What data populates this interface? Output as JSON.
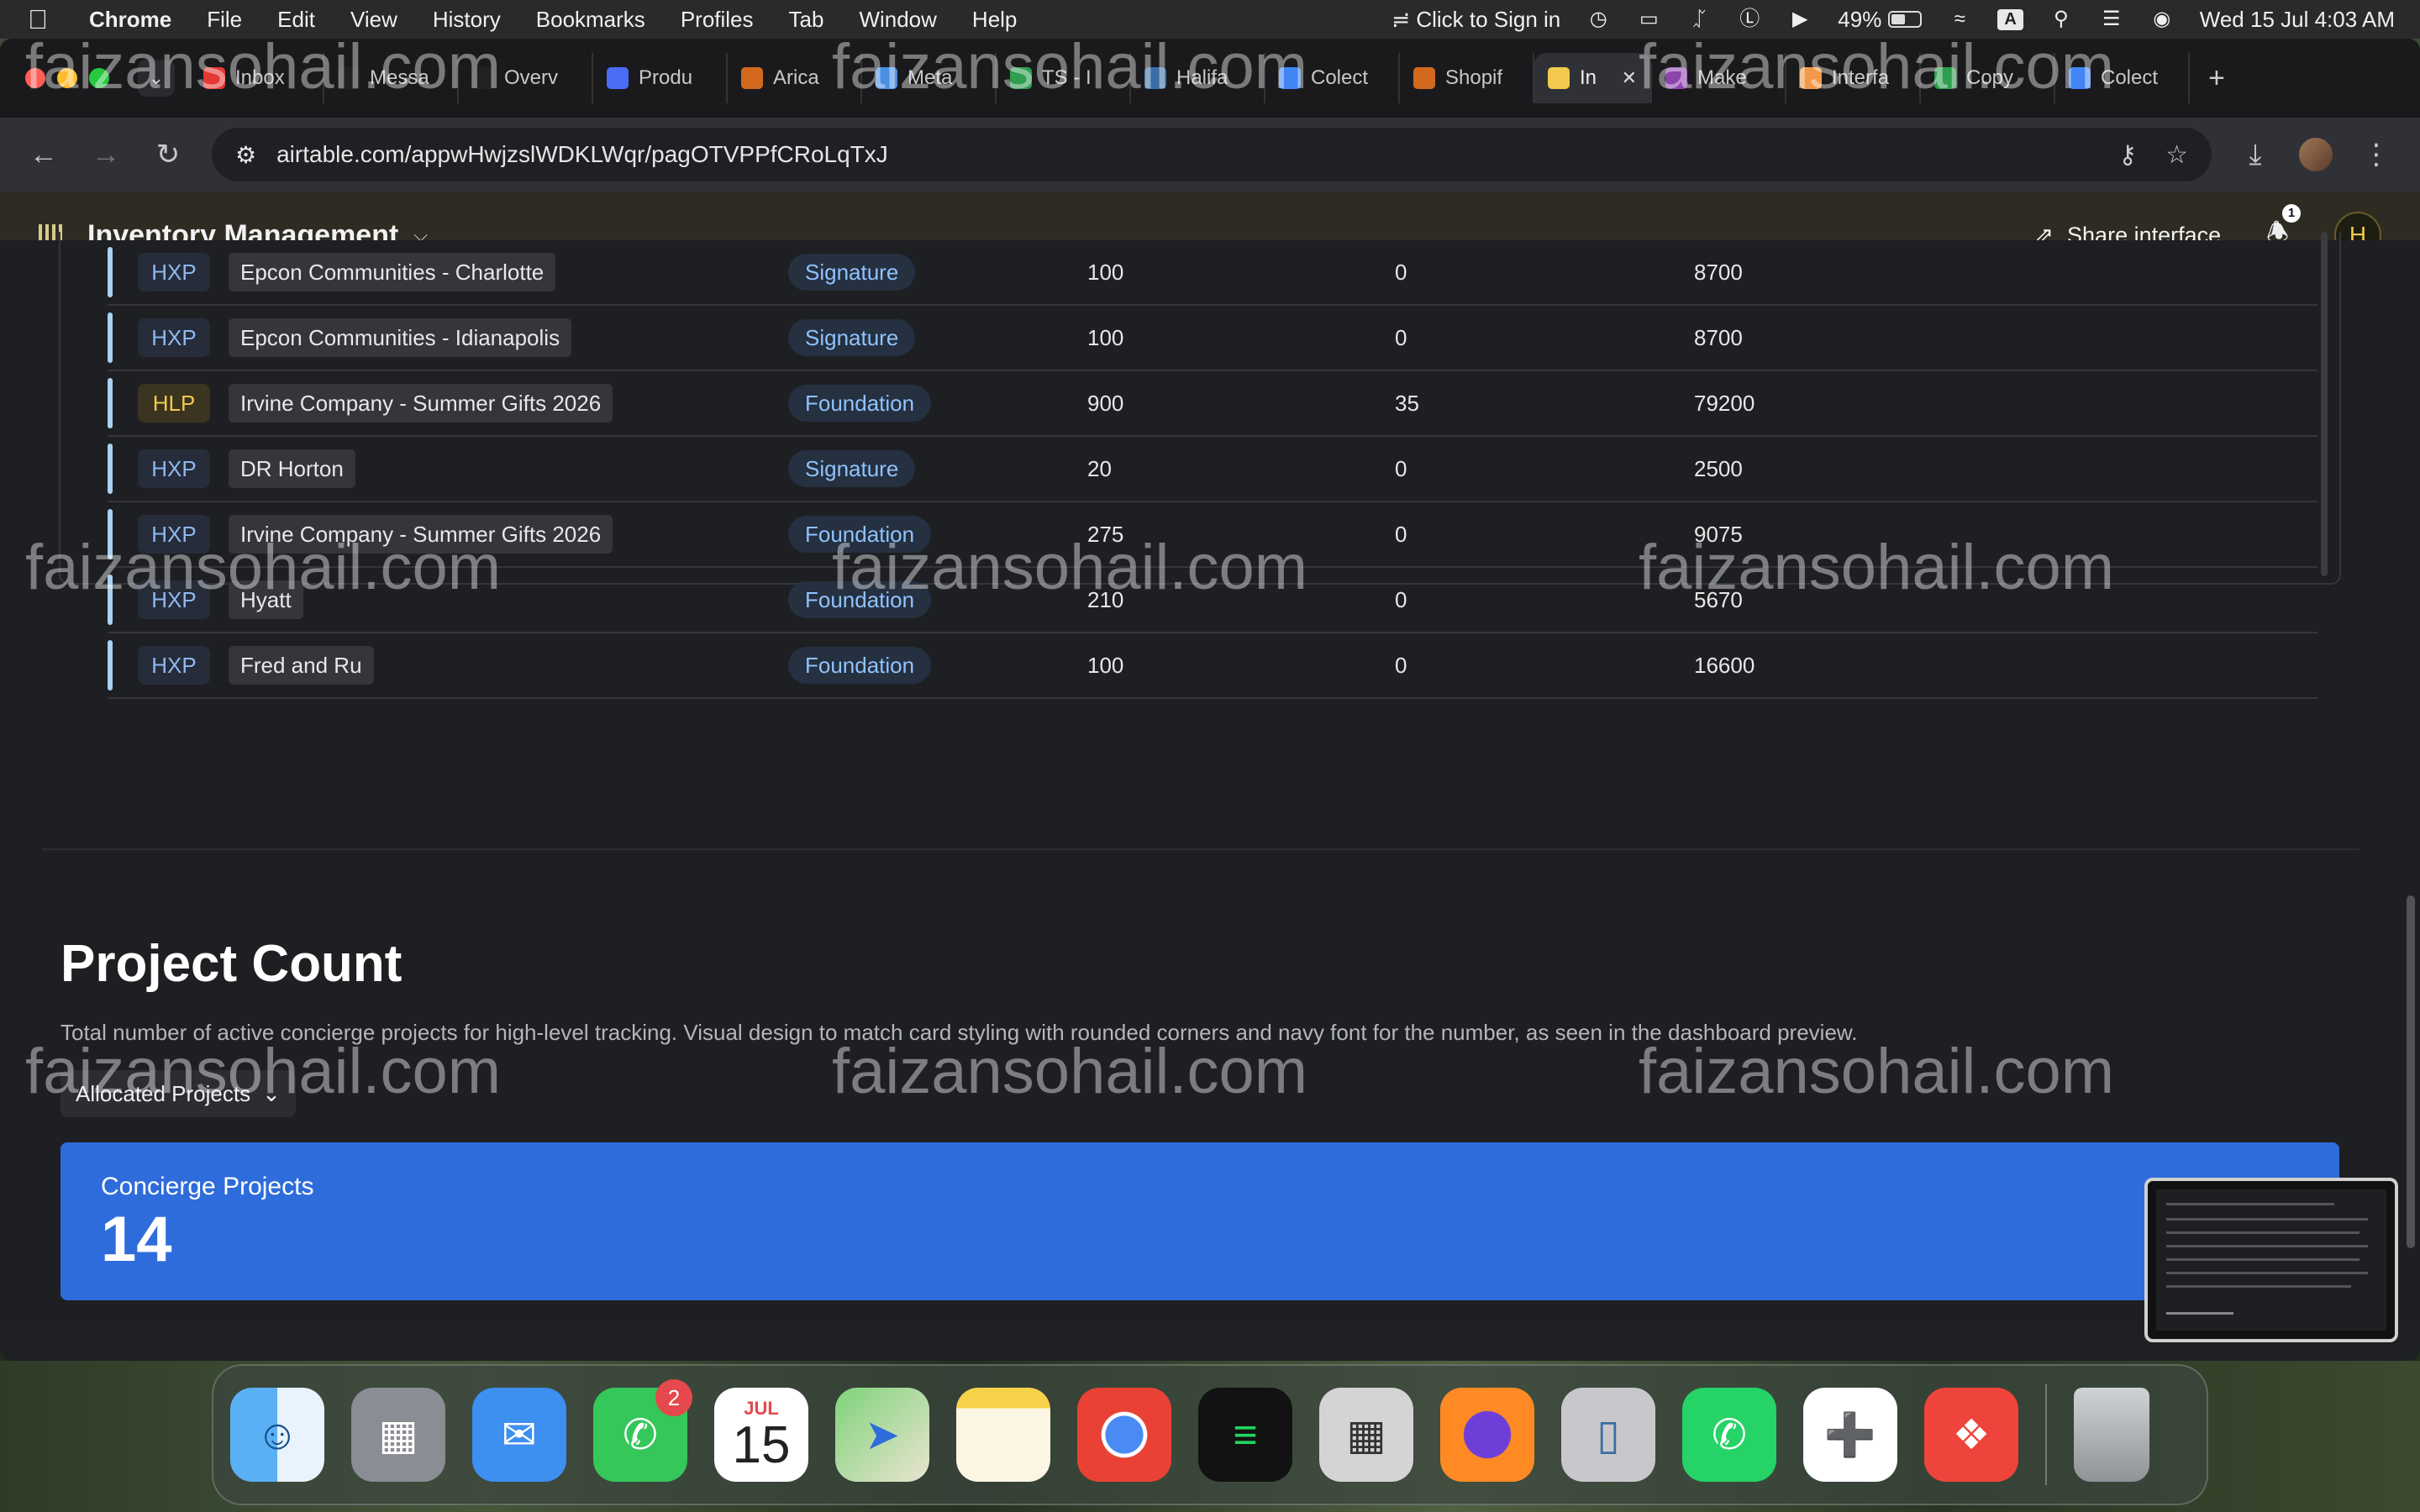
{
  "menubar": {
    "app_name": "Chrome",
    "items": [
      "File",
      "Edit",
      "View",
      "History",
      "Bookmarks",
      "Profiles",
      "Tab",
      "Window",
      "Help"
    ],
    "sign_in": "Click to Sign in",
    "battery_pct": "49%",
    "battery_level": 0.49,
    "input_source": "A",
    "datetime": "Wed 15 Jul  4:03 AM"
  },
  "tabs": [
    {
      "title": "Inbox",
      "favicon_color": "#e53935"
    },
    {
      "title": "Messa",
      "favicon_color": "#222222"
    },
    {
      "title": "Overv",
      "favicon_color": "#222222"
    },
    {
      "title": "Produ",
      "favicon_color": "#4a6cf7"
    },
    {
      "title": "Arica",
      "favicon_color": "#d2691e"
    },
    {
      "title": "Meta",
      "favicon_color": "#4a90e2"
    },
    {
      "title": "TS - I",
      "favicon_color": "#2e9e4f"
    },
    {
      "title": "Halifa",
      "favicon_color": "#3a6ea5"
    },
    {
      "title": "Colect",
      "favicon_color": "#4285f4"
    },
    {
      "title": "Shopif",
      "favicon_color": "#d2691e"
    },
    {
      "title": "In",
      "favicon_color": "#f2c94c",
      "active": true
    },
    {
      "title": "Make",
      "favicon_color": "#8e44ad"
    },
    {
      "title": "Interfa",
      "favicon_color": "#f2994a"
    },
    {
      "title": "Copy",
      "favicon_color": "#2e9e4f"
    },
    {
      "title": "Colect",
      "favicon_color": "#4285f4"
    }
  ],
  "address_bar": {
    "url": "airtable.com/appwHwjzslWDKLWqr/pagOTVPPfCRoLqTxJ"
  },
  "app": {
    "title": "Inventory Management",
    "share_label": "Share interface",
    "notification_count": "1",
    "user_initial": "H"
  },
  "table": {
    "rows": [
      {
        "code": "HXP",
        "name": "Epcon Communities - Charlotte",
        "tier": "Signature",
        "n1": "100",
        "n2": "0",
        "n3": "8700"
      },
      {
        "code": "HXP",
        "name": "Epcon Communities - Idianapolis",
        "tier": "Signature",
        "n1": "100",
        "n2": "0",
        "n3": "8700"
      },
      {
        "code": "HLP",
        "name": "Irvine Company - Summer Gifts 2026",
        "tier": "Foundation",
        "n1": "900",
        "n2": "35",
        "n3": "79200"
      },
      {
        "code": "HXP",
        "name": "DR Horton",
        "tier": "Signature",
        "n1": "20",
        "n2": "0",
        "n3": "2500"
      },
      {
        "code": "HXP",
        "name": "Irvine Company - Summer Gifts 2026",
        "tier": "Foundation",
        "n1": "275",
        "n2": "0",
        "n3": "9075"
      },
      {
        "code": "HXP",
        "name": "Hyatt",
        "tier": "Foundation",
        "n1": "210",
        "n2": "0",
        "n3": "5670"
      },
      {
        "code": "HXP",
        "name": "Fred and Ru",
        "tier": "Foundation",
        "n1": "100",
        "n2": "0",
        "n3": "16600"
      }
    ]
  },
  "section": {
    "title": "Project Count",
    "description": "Total number of active concierge projects for high-level tracking. Visual design to match card styling with rounded corners and navy font for the number, as seen in the dashboard preview.",
    "filter_label": "Allocated Projects",
    "kpi_label": "Concierge Projects",
    "kpi_value": "14",
    "kpi_color": "#2f6cdb"
  },
  "watermark": "faizansohail.com",
  "dock": {
    "calendar_month": "JUL",
    "calendar_day": "15",
    "messages_badge": "2",
    "apps": [
      "finder",
      "launchpad",
      "mail",
      "messages",
      "calendar",
      "maps",
      "notes",
      "chrome",
      "spotify",
      "calculator",
      "firefox",
      "iphone-mirroring",
      "whatsapp",
      "slack",
      "anydesk",
      "trash"
    ]
  }
}
